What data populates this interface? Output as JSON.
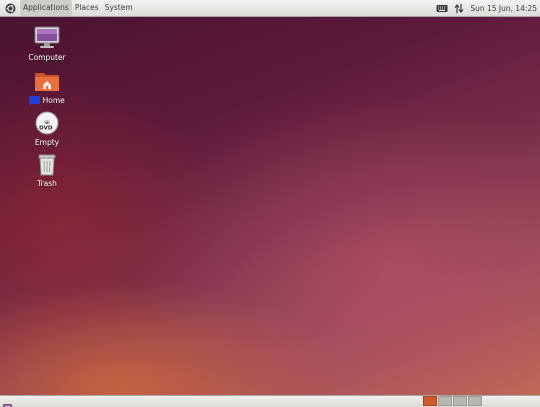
{
  "top_panel": {
    "menus": [
      {
        "label": "Applications",
        "active": true
      },
      {
        "label": "Places",
        "active": false
      },
      {
        "label": "System",
        "active": false
      }
    ],
    "indicators": {
      "keyboard_icon": "keyboard-icon",
      "network_icon": "network-updown-icon",
      "clock": "Sun 15 Jun, 14:25"
    }
  },
  "desktop": {
    "icons": [
      {
        "name": "computer",
        "label": "Computer",
        "icon": "monitor-icon"
      },
      {
        "name": "home",
        "label_prefix": "",
        "label": "Home",
        "icon": "home-folder-icon"
      },
      {
        "name": "dvd",
        "label": "Empty",
        "icon": "dvd-icon"
      },
      {
        "name": "trash",
        "label": "Trash",
        "icon": "trash-icon"
      }
    ]
  },
  "bottom_panel": {
    "show_desktop_icon": "show-desktop-icon",
    "workspaces": [
      {
        "active": true
      },
      {
        "active": false
      },
      {
        "active": false
      },
      {
        "active": false
      }
    ]
  },
  "colors": {
    "accent_orange": "#d0592e",
    "selection_blue": "#1f3fd6",
    "panel_bg": "#e8e6e3"
  }
}
